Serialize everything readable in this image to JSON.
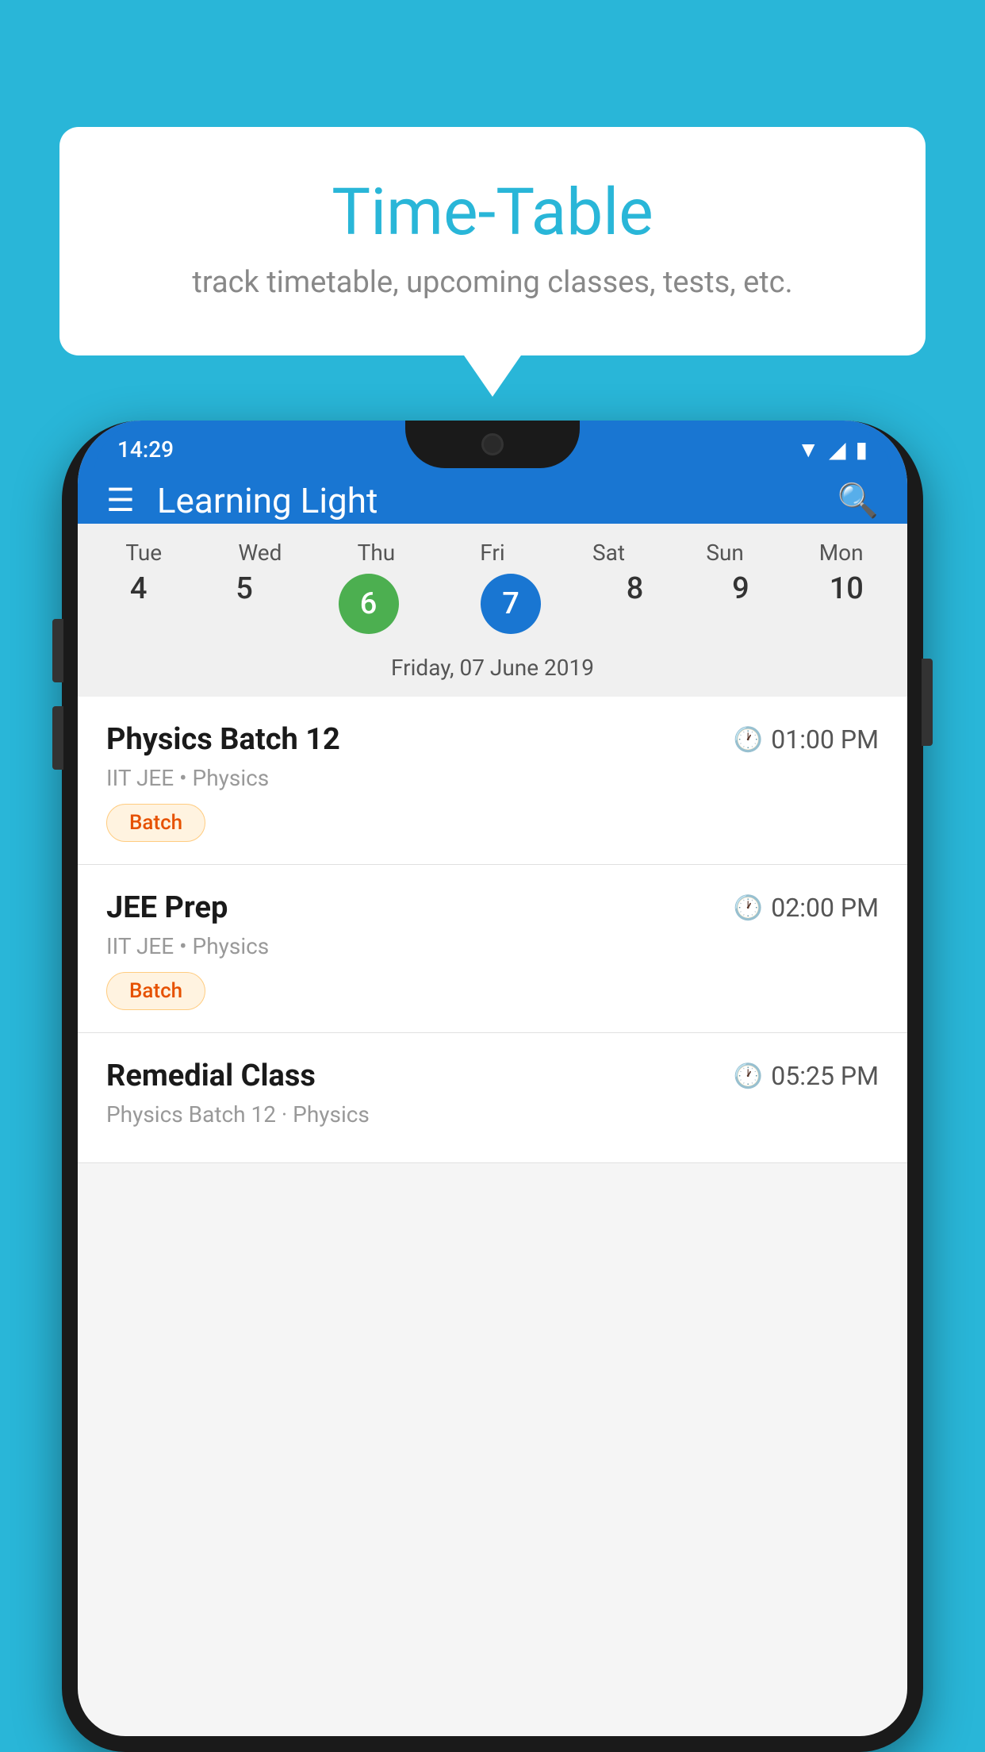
{
  "background_color": "#29B6D8",
  "speech_bubble": {
    "title": "Time-Table",
    "subtitle": "track timetable, upcoming classes, tests, etc."
  },
  "phone": {
    "status_bar": {
      "time": "14:29"
    },
    "app_header": {
      "title": "Learning Light"
    },
    "calendar": {
      "days": [
        "Tue",
        "Wed",
        "Thu",
        "Fri",
        "Sat",
        "Sun",
        "Mon"
      ],
      "dates": [
        "4",
        "5",
        "6",
        "7",
        "8",
        "9",
        "10"
      ],
      "today_index": 2,
      "selected_index": 3,
      "selected_date_label": "Friday, 07 June 2019"
    },
    "schedule": [
      {
        "title": "Physics Batch 12",
        "time": "01:00 PM",
        "subtitle": "IIT JEE • Physics",
        "badge": "Batch"
      },
      {
        "title": "JEE Prep",
        "time": "02:00 PM",
        "subtitle": "IIT JEE • Physics",
        "badge": "Batch"
      },
      {
        "title": "Remedial Class",
        "time": "05:25 PM",
        "subtitle": "Physics Batch 12 · Physics",
        "badge": null
      }
    ]
  }
}
